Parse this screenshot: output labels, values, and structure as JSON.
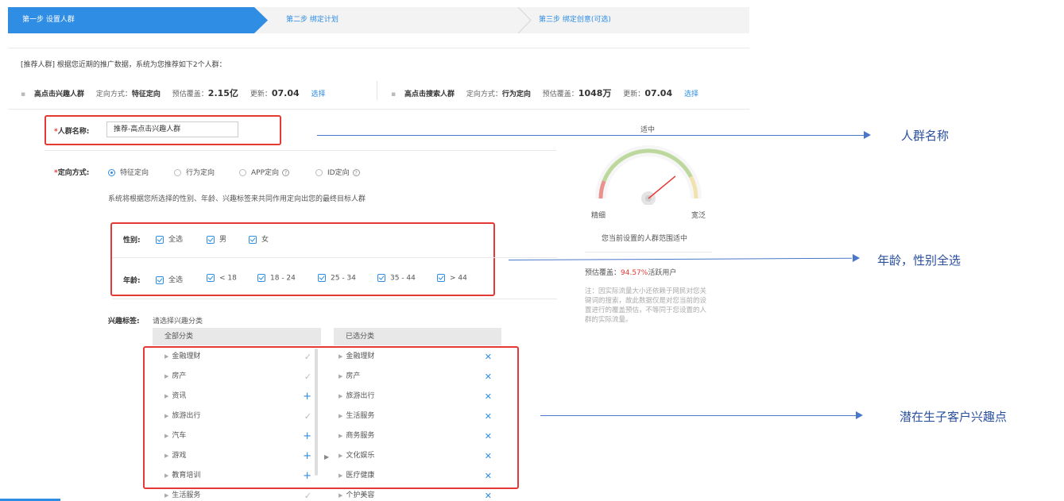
{
  "steps": {
    "step1": "第一步 设置人群",
    "step2": "第二步 绑定计划",
    "step3": "第三步 绑定创意(可选)"
  },
  "recommend": {
    "title": "[推荐人群] 根据您近期的推广数据，系统为您推荐如下2个人群：",
    "items": [
      {
        "name": "高点击兴趣人群",
        "mode_label": "定向方式：",
        "mode": "特征定向",
        "cover_label": "预估覆盖：",
        "cover": "2.15亿",
        "update_label": "更新：",
        "update": "07.04",
        "action": "选择"
      },
      {
        "name": "高点击搜索人群",
        "mode_label": "定向方式：",
        "mode": "行为定向",
        "cover_label": "预估覆盖：",
        "cover": "1048万",
        "update_label": "更新：",
        "update": "07.04",
        "action": "选择"
      }
    ]
  },
  "form": {
    "name_label": "人群名称:",
    "name_value": "推荐-高点击兴趣人群",
    "mode_label": "定向方式:",
    "modes": [
      "特征定向",
      "行为定向",
      "APP定向",
      "ID定向"
    ],
    "mode_selected": "特征定向",
    "mode_hint": "系统将根据您所选择的性别、年龄、兴趣标签来共同作用定向出您的最终目标人群",
    "gender_label": "性别:",
    "genders": [
      "全选",
      "男",
      "女"
    ],
    "age_label": "年龄:",
    "ages": [
      "全选",
      "< 18",
      "18 - 24",
      "25 - 34",
      "35 - 44",
      "> 44"
    ],
    "interest_label": "兴趣标签:",
    "interest_hint": "请选择兴趣分类"
  },
  "all_categories": {
    "header": "全部分类",
    "items": [
      {
        "label": "金融理财",
        "action": "check"
      },
      {
        "label": "房产",
        "action": "check"
      },
      {
        "label": "资讯",
        "action": "plus"
      },
      {
        "label": "旅游出行",
        "action": "check"
      },
      {
        "label": "汽车",
        "action": "plus"
      },
      {
        "label": "游戏",
        "action": "plus"
      },
      {
        "label": "教育培训",
        "action": "plus"
      },
      {
        "label": "生活服务",
        "action": "check"
      }
    ]
  },
  "selected_categories": {
    "header": "已选分类",
    "items": [
      "金融理财",
      "房产",
      "旅游出行",
      "生活服务",
      "商务服务",
      "文化娱乐",
      "医疗健康",
      "个护美容"
    ]
  },
  "gauge": {
    "top_label": "适中",
    "left_label": "精细",
    "right_label": "宽泛",
    "status": "您当前设置的人群范围适中",
    "level_fraction": 0.78,
    "colors": {
      "low": "#e53935",
      "mid": "#8bc34a",
      "high": "#f5d76e"
    }
  },
  "coverage": {
    "label": "预估覆盖：",
    "value": "94.57%",
    "suffix": "活跃用户",
    "note": "注：因实际流量大小还依赖于网民对您关键词的搜索，故此数据仅是对您当前的设置进行的覆盖预估，不等同于您设置的人群的实际流量。"
  },
  "annotations": {
    "name": "人群名称",
    "age_gender": "年龄，性别全选",
    "interest": "潜在生子客户兴趣点"
  },
  "colors": {
    "accent": "#2f8de4",
    "highlight": "#e53935",
    "annotation": "#4a77c9"
  }
}
